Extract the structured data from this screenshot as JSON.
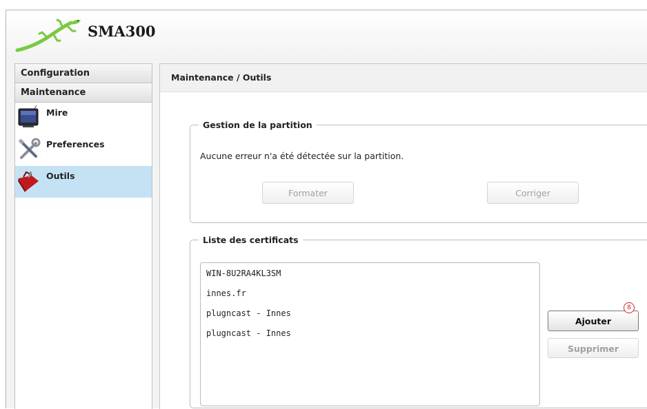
{
  "app": {
    "title": "SMA300",
    "logo_icon": "gecko-logo"
  },
  "sidebar": {
    "sections": [
      {
        "label": "Configuration"
      },
      {
        "label": "Maintenance"
      }
    ],
    "items": [
      {
        "label": "Mire",
        "icon": "monitor-icon",
        "selected": false
      },
      {
        "label": "Preferences",
        "icon": "tools-icon",
        "selected": false
      },
      {
        "label": "Outils",
        "icon": "toolbox-icon",
        "selected": true
      }
    ]
  },
  "main": {
    "breadcrumb": "Maintenance / Outils",
    "partition": {
      "legend": "Gestion de la partition",
      "message": "Aucune erreur n'a été détectée sur la partition.",
      "format_button": "Formater",
      "fix_button": "Corriger"
    },
    "certificates": {
      "legend": "Liste des certificats",
      "items": [
        "WIN-8U2RA4KL3SM",
        "innes.fr",
        "plugncast - Innes",
        "plugncast - Innes"
      ],
      "add_button": "Ajouter",
      "remove_button": "Supprimer",
      "annotation": "8"
    }
  },
  "colors": {
    "selected_bg": "#c4e2f4",
    "accent_green": "#7ac943",
    "annotation_red": "#d62020"
  }
}
